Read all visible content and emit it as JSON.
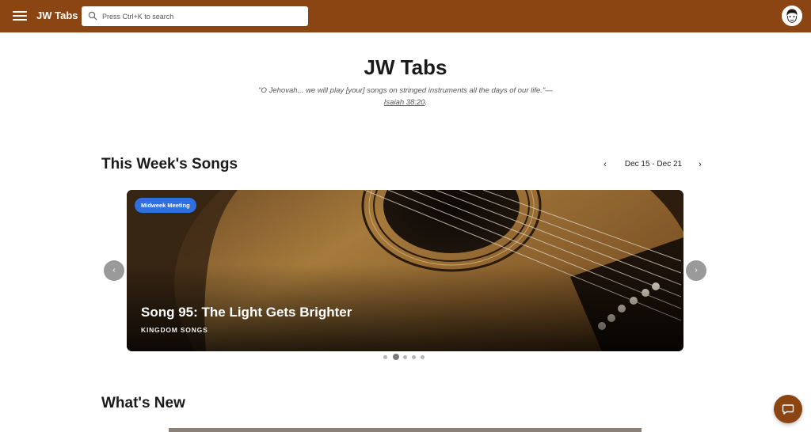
{
  "header": {
    "brand": "JW Tabs",
    "search_placeholder": "Press Ctrl+K to search",
    "icons": [
      "menu-icon",
      "search-icon",
      "avatar"
    ]
  },
  "hero": {
    "title": "JW Tabs",
    "quote": "\"O Jehovah... we will play [your] songs on stringed instruments all the days of our life.\"—",
    "reference": "Isaiah 38:20",
    "reference_suffix": "."
  },
  "weekly": {
    "title": "This Week's Songs",
    "date_range": "Dec 15 - Dec 21",
    "prev_icon": "chevron-left-icon",
    "next_icon": "chevron-right-icon",
    "slide": {
      "badge": "Midweek Meeting",
      "title": "Song 95: The Light Gets Brighter",
      "category": "KINGDOM SONGS"
    },
    "slide_count": 5,
    "active_slide": 2
  },
  "whats_new": {
    "title": "What's New"
  },
  "colors": {
    "header": "#8b4513",
    "badge": "#2f6fe0",
    "chat": "#8b4513"
  }
}
